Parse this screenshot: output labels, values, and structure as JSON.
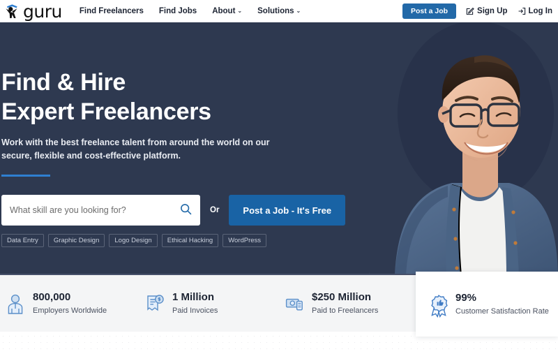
{
  "brand": {
    "name": "guru",
    "logo_icon": "guru-stick-figure-icon",
    "accent_blue": "#2269a8",
    "hero_bg": "#2e3950"
  },
  "navbar": {
    "links": [
      {
        "label": "Find Freelancers",
        "has_caret": false
      },
      {
        "label": "Find Jobs",
        "has_caret": false
      },
      {
        "label": "About",
        "has_caret": true
      },
      {
        "label": "Solutions",
        "has_caret": true
      }
    ],
    "caret_glyph": "⌄",
    "post_job_label": "Post a Job",
    "sign_up_label": "Sign Up",
    "sign_up_icon": "pencil-square-icon",
    "log_in_label": "Log In",
    "log_in_icon": "login-arrow-icon"
  },
  "hero": {
    "heading_line1": "Find & Hire",
    "heading_line2": "Expert Freelancers",
    "subtitle": "Work with the best freelance talent from around the world on our secure, flexible and cost-effective platform.",
    "search_placeholder": "What skill are you looking for?",
    "search_value": "",
    "search_icon": "search-icon",
    "or_label": "Or",
    "cta_label": "Post a Job - It's Free",
    "tags": [
      "Data Entry",
      "Graphic Design",
      "Logo Design",
      "Ethical Hacking",
      "WordPress"
    ],
    "photo_alt": "smiling-man-with-glasses-photo"
  },
  "stats": [
    {
      "icon": "employer-person-icon",
      "value": "800,000",
      "label": "Employers Worldwide"
    },
    {
      "icon": "invoice-dollar-icon",
      "value": "1 Million",
      "label": "Paid Invoices"
    },
    {
      "icon": "cash-money-icon",
      "value": "$250 Million",
      "label": "Paid to Freelancers"
    }
  ],
  "highlight_card": {
    "icon": "award-ribbon-thumbsup-icon",
    "value": "99%",
    "label": "Customer Satisfaction Rate"
  }
}
